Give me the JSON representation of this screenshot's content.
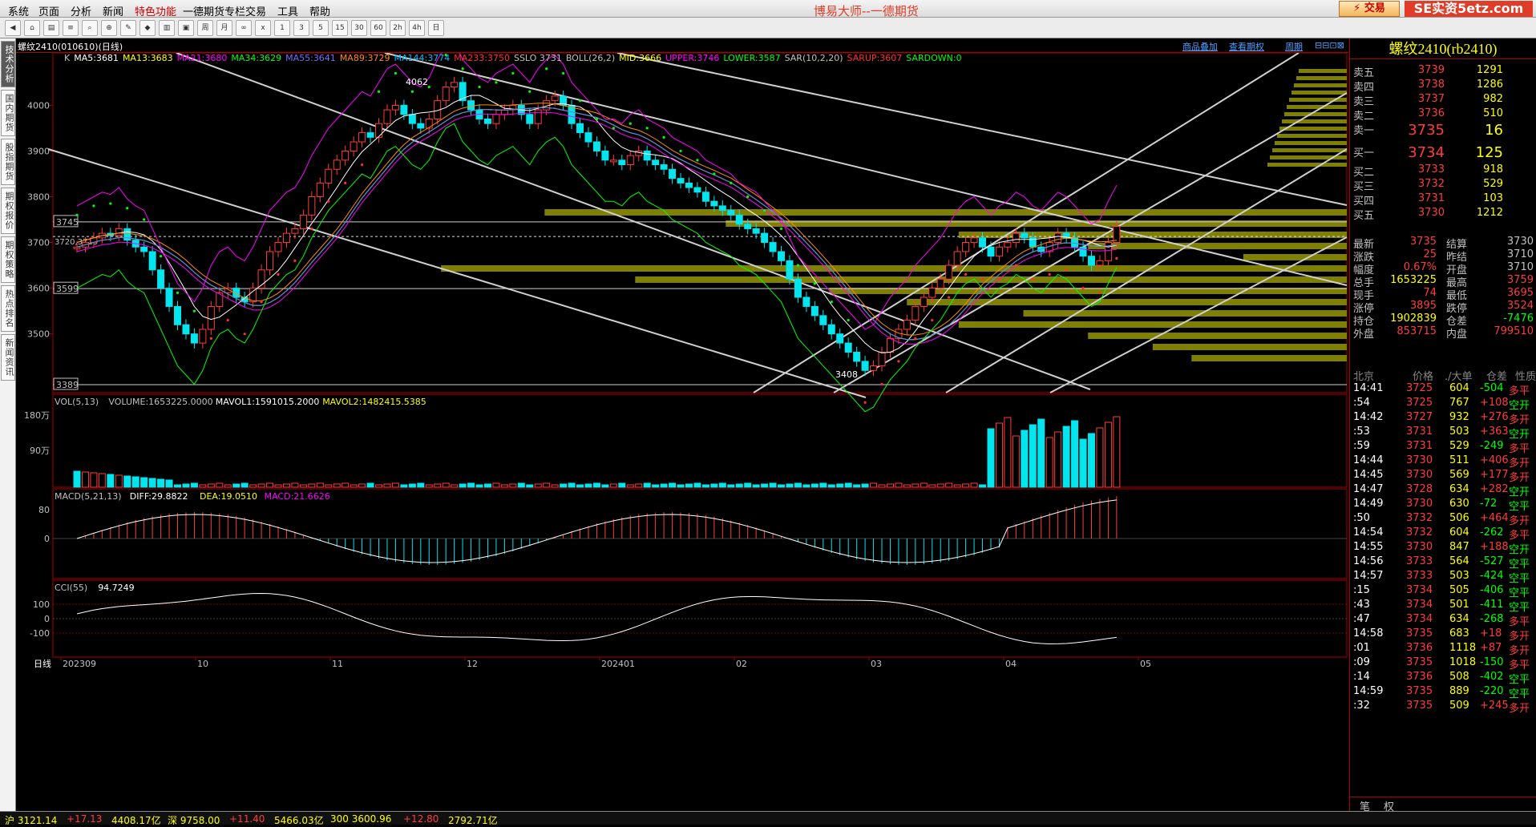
{
  "menu": [
    "系统",
    "页面",
    "分析",
    "新闻",
    "特色功能",
    "一德期货专栏",
    "交易",
    "工具",
    "帮助"
  ],
  "app_title": "博易大师--一德期货",
  "trade_label": "⚡ 交易",
  "logo": "SE实资5etz.com",
  "toolbar_icons": [
    "back-icon",
    "home-icon",
    "chart-icon",
    "list-icon",
    "search-icon",
    "zoom-icon",
    "pencil-icon",
    "draw-icon",
    "tick-icon",
    "box-icon",
    "周",
    "月",
    "∞",
    "x",
    "1",
    "3",
    "5",
    "15",
    "30",
    "60",
    "2h",
    "4h",
    "日"
  ],
  "sidebar_tabs": [
    "技术分析",
    "国内期货",
    "股指期货",
    "期权报价",
    "期权策略",
    "热点排名",
    "新闻资讯"
  ],
  "chart": {
    "header": "螺纹2410(010610)(日线)",
    "links": [
      "商品叠加",
      "查看期权",
      "周期"
    ],
    "legend": [
      {
        "text": "K",
        "color": "#c0c0c0"
      },
      {
        "text": "MA5:3681",
        "color": "#ffffff"
      },
      {
        "text": "MA13:3683",
        "color": "#ffff00"
      },
      {
        "text": "MA21:3680",
        "color": "#ff00ff"
      },
      {
        "text": "MA34:3629",
        "color": "#00ff00"
      },
      {
        "text": "MA55:3641",
        "color": "#6f6fff"
      },
      {
        "text": "MA89:3729",
        "color": "#ff8c00"
      },
      {
        "text": "MA144:3774",
        "color": "#00c0ff"
      },
      {
        "text": "MA233:3750",
        "color": "#ff3030"
      },
      {
        "text": "SSLO 3731",
        "color": "#c0c0c0"
      },
      {
        "text": "BOLL(26,2)",
        "color": "#c0c0c0"
      },
      {
        "text": "MID:3666",
        "color": "#ffff00"
      },
      {
        "text": "UPPER:3746",
        "color": "#ff00ff"
      },
      {
        "text": "LOWER:3587",
        "color": "#00ff00"
      },
      {
        "text": "SAR(10,2,20)",
        "color": "#c0c0c0"
      },
      {
        "text": "SARUP:3607",
        "color": "#ff3030"
      },
      {
        "text": "SARDOWN:0",
        "color": "#00ff00"
      }
    ],
    "y_labels": [
      "4000",
      "3900",
      "3800",
      "3700",
      "3600",
      "3500"
    ],
    "price_boxes": [
      "3745",
      "3599",
      "3389"
    ],
    "high_label": "4062",
    "low_label": "3408",
    "cursor_label": "3720,3713",
    "vol_legend": [
      {
        "text": "VOL(5,13)",
        "color": "#c0c0c0"
      },
      {
        "text": "VOLUME:1653225.0000",
        "color": "#c0c0c0"
      },
      {
        "text": "MAVOL1:1591015.2000",
        "color": "#ffffff"
      },
      {
        "text": "MAVOL2:1482415.5385",
        "color": "#ffff00"
      }
    ],
    "vol_labels": [
      "180万",
      "90万"
    ],
    "macd_legend": [
      {
        "text": "MACD(5,21,13)",
        "color": "#c0c0c0"
      },
      {
        "text": "DIFF:29.8822",
        "color": "#ffffff"
      },
      {
        "text": "DEA:19.0510",
        "color": "#ffff00"
      },
      {
        "text": "MACD:21.6626",
        "color": "#ff00ff"
      }
    ],
    "macd_labels": [
      "80",
      "0"
    ],
    "cci_legend": [
      {
        "text": "CCI(55)",
        "color": "#c0c0c0"
      },
      {
        "text": "94.7249",
        "color": "#ffffff"
      }
    ],
    "cci_labels": [
      "100",
      "0",
      "-100"
    ],
    "period_label": "日线",
    "dates": [
      "202309",
      "10",
      "11",
      "12",
      "202401",
      "02",
      "03",
      "04",
      "05"
    ]
  },
  "chart_data": {
    "type": "candlestick",
    "symbol": "螺纹2410",
    "yrange": [
      3389,
      4062
    ],
    "closes": [
      3690,
      3700,
      3710,
      3720,
      3715,
      3730,
      3705,
      3690,
      3680,
      3640,
      3600,
      3560,
      3520,
      3500,
      3480,
      3510,
      3560,
      3590,
      3600,
      3580,
      3570,
      3600,
      3640,
      3680,
      3700,
      3720,
      3730,
      3760,
      3800,
      3830,
      3860,
      3880,
      3900,
      3920,
      3940,
      3930,
      3960,
      3990,
      4000,
      3980,
      3960,
      3950,
      3970,
      4010,
      4040,
      4050,
      4010,
      3990,
      3970,
      3960,
      3980,
      3990,
      4000,
      3980,
      3960,
      3990,
      4010,
      4020,
      4000,
      3960,
      3940,
      3920,
      3900,
      3880,
      3880,
      3870,
      3890,
      3900,
      3880,
      3870,
      3860,
      3840,
      3830,
      3820,
      3810,
      3790,
      3780,
      3770,
      3760,
      3740,
      3730,
      3720,
      3700,
      3680,
      3660,
      3620,
      3580,
      3560,
      3540,
      3520,
      3500,
      3480,
      3460,
      3440,
      3420,
      3430,
      3460,
      3490,
      3510,
      3530,
      3560,
      3580,
      3600,
      3620,
      3650,
      3680,
      3700,
      3710,
      3690,
      3670,
      3690,
      3700,
      3720,
      3710,
      3690,
      3680,
      3700,
      3720,
      3710,
      3690,
      3670,
      3650,
      3660,
      3700,
      3735
    ],
    "volume_recent_max": 1800000
  },
  "quote": {
    "title": "螺纹2410(rb2410)",
    "asks": [
      {
        "l": "卖五",
        "p": "3739",
        "v": "1291"
      },
      {
        "l": "卖四",
        "p": "3738",
        "v": "1286"
      },
      {
        "l": "卖三",
        "p": "3737",
        "v": "982"
      },
      {
        "l": "卖二",
        "p": "3736",
        "v": "510"
      },
      {
        "l": "卖一",
        "p": "3735",
        "v": "16"
      }
    ],
    "bids": [
      {
        "l": "买一",
        "p": "3734",
        "v": "125"
      },
      {
        "l": "买二",
        "p": "3733",
        "v": "918"
      },
      {
        "l": "买三",
        "p": "3732",
        "v": "529"
      },
      {
        "l": "买四",
        "p": "3731",
        "v": "103"
      },
      {
        "l": "买五",
        "p": "3730",
        "v": "1212"
      }
    ],
    "stats": [
      {
        "l1": "最新",
        "v1": "3735",
        "l2": "结算",
        "v2": "3730"
      },
      {
        "l1": "涨跌",
        "v1": "25",
        "l2": "昨结",
        "v2": "3710"
      },
      {
        "l1": "幅度",
        "v1": "0.67%",
        "l2": "开盘",
        "v2": "3710"
      },
      {
        "l1": "总手",
        "v1": "1653225",
        "l2": "最高",
        "v2": "3759"
      },
      {
        "l1": "现手",
        "v1": "74",
        "l2": "最低",
        "v2": "3695"
      },
      {
        "l1": "涨停",
        "v1": "3895",
        "l2": "跌停",
        "v2": "3524"
      },
      {
        "l1": "持仓",
        "v1": "1902839",
        "l2": "仓差",
        "v2": "-7476"
      },
      {
        "l1": "外盘",
        "v1": "853715",
        "l2": "内盘",
        "v2": "799510"
      }
    ],
    "tick_header": [
      "北京",
      "价格",
      "./大单",
      "仓差",
      "性质"
    ],
    "ticks": [
      {
        "t": "14:41",
        "p": "3725",
        "v": "604",
        "d": "-504",
        "k": "多平"
      },
      {
        "t": ":54",
        "p": "3725",
        "v": "767",
        "d": "+108",
        "k": "空开"
      },
      {
        "t": "14:42",
        "p": "3727",
        "v": "932",
        "d": "+276",
        "k": "多开"
      },
      {
        "t": ":53",
        "p": "3731",
        "v": "503",
        "d": "+363",
        "k": "空开"
      },
      {
        "t": ":59",
        "p": "3731",
        "v": "529",
        "d": "-249",
        "k": "多平"
      },
      {
        "t": "14:44",
        "p": "3730",
        "v": "511",
        "d": "+406",
        "k": "多开"
      },
      {
        "t": "14:45",
        "p": "3730",
        "v": "569",
        "d": "+177",
        "k": "多开"
      },
      {
        "t": "14:47",
        "p": "3728",
        "v": "634",
        "d": "+282",
        "k": "空开"
      },
      {
        "t": "14:49",
        "p": "3730",
        "v": "630",
        "d": "-72",
        "k": "空平"
      },
      {
        "t": ":50",
        "p": "3732",
        "v": "506",
        "d": "+464",
        "k": "多开"
      },
      {
        "t": "14:54",
        "p": "3732",
        "v": "604",
        "d": "-262",
        "k": "多平"
      },
      {
        "t": "14:55",
        "p": "3730",
        "v": "847",
        "d": "+188",
        "k": "空开"
      },
      {
        "t": "14:56",
        "p": "3733",
        "v": "564",
        "d": "-527",
        "k": "空平"
      },
      {
        "t": "14:57",
        "p": "3733",
        "v": "503",
        "d": "-424",
        "k": "空平"
      },
      {
        "t": ":15",
        "p": "3734",
        "v": "505",
        "d": "-406",
        "k": "空平"
      },
      {
        "t": ":43",
        "p": "3734",
        "v": "501",
        "d": "-411",
        "k": "空平"
      },
      {
        "t": ":47",
        "p": "3734",
        "v": "634",
        "d": "-268",
        "k": "多平"
      },
      {
        "t": "14:58",
        "p": "3735",
        "v": "683",
        "d": "+18",
        "k": "多开"
      },
      {
        "t": ":01",
        "p": "3736",
        "v": "1118",
        "d": "+87",
        "k": "多开"
      },
      {
        "t": ":09",
        "p": "3735",
        "v": "1018",
        "d": "-150",
        "k": "多平"
      },
      {
        "t": ":14",
        "p": "3736",
        "v": "508",
        "d": "-402",
        "k": "空平"
      },
      {
        "t": "14:59",
        "p": "3735",
        "v": "889",
        "d": "-220",
        "k": "空平"
      },
      {
        "t": ":32",
        "p": "3735",
        "v": "509",
        "d": "+245",
        "k": "多开"
      }
    ],
    "bottom_tabs": [
      "笔",
      "权"
    ]
  },
  "statusbar": [
    "沪 3121.14",
    "+17.13",
    "4408.17亿",
    "深 9758.00",
    "+11.40",
    "5466.03亿",
    "300 3600.96",
    "+12.80",
    "2792.71亿"
  ]
}
